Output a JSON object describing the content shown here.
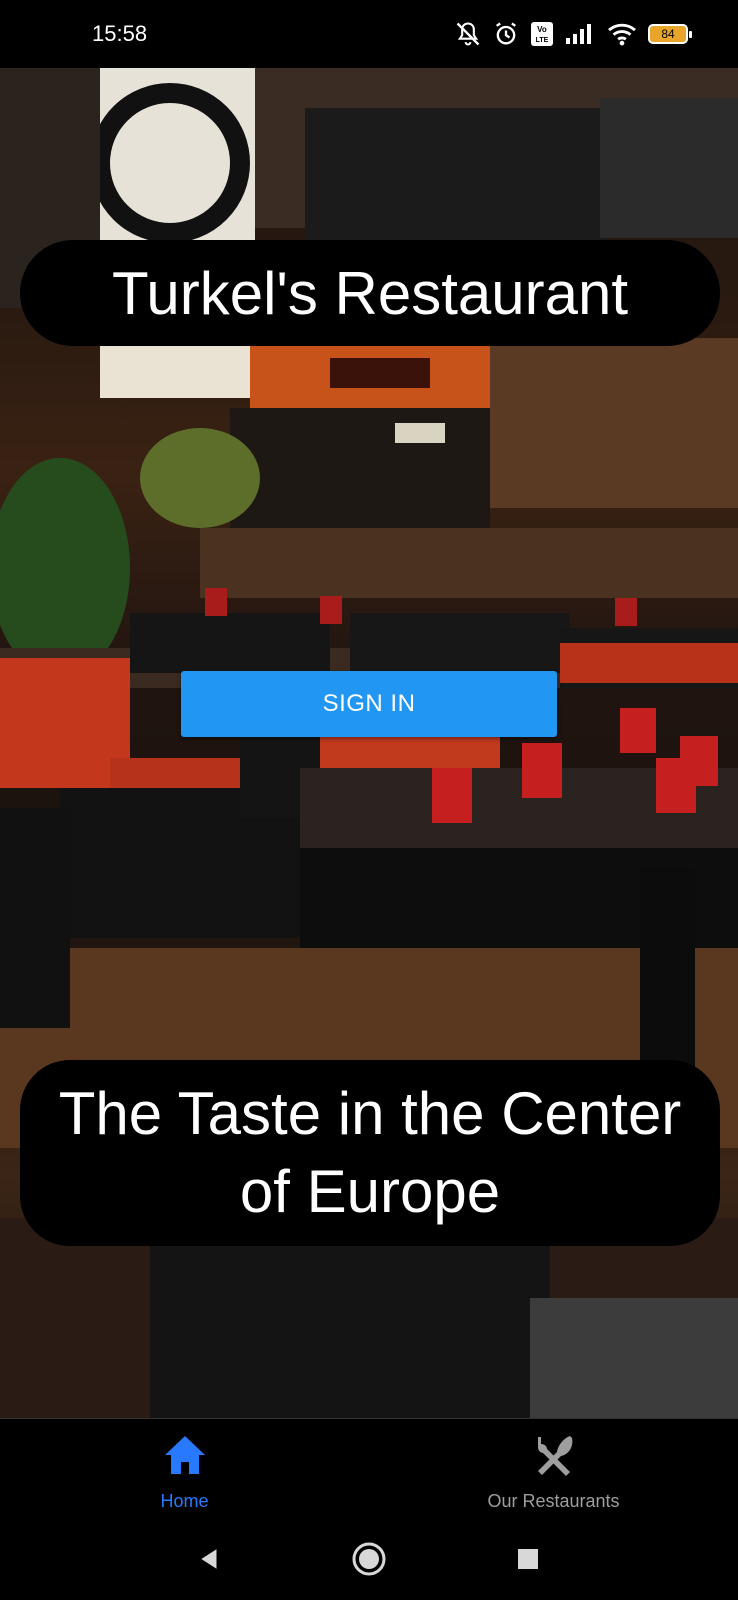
{
  "status_bar": {
    "time": "15:58",
    "battery_level": "84",
    "icons": [
      "muted-notification-icon",
      "alarm-icon",
      "volte-icon",
      "signal-icon",
      "wifi-icon",
      "battery-icon"
    ]
  },
  "hero": {
    "title": "Turkel's Restaurant",
    "tagline": "The Taste in the Center of Europe",
    "sign_in_label": "SIGN IN"
  },
  "bottom_nav": {
    "items": [
      {
        "label": "Home",
        "icon": "home-icon",
        "active": true
      },
      {
        "label": "Our Restaurants",
        "icon": "fork-knife-icon",
        "active": false
      }
    ]
  },
  "colors": {
    "accent": "#2196f3",
    "active_nav": "#2979ff",
    "inactive_nav": "#9e9e9e",
    "battery": "#e8a52a"
  }
}
